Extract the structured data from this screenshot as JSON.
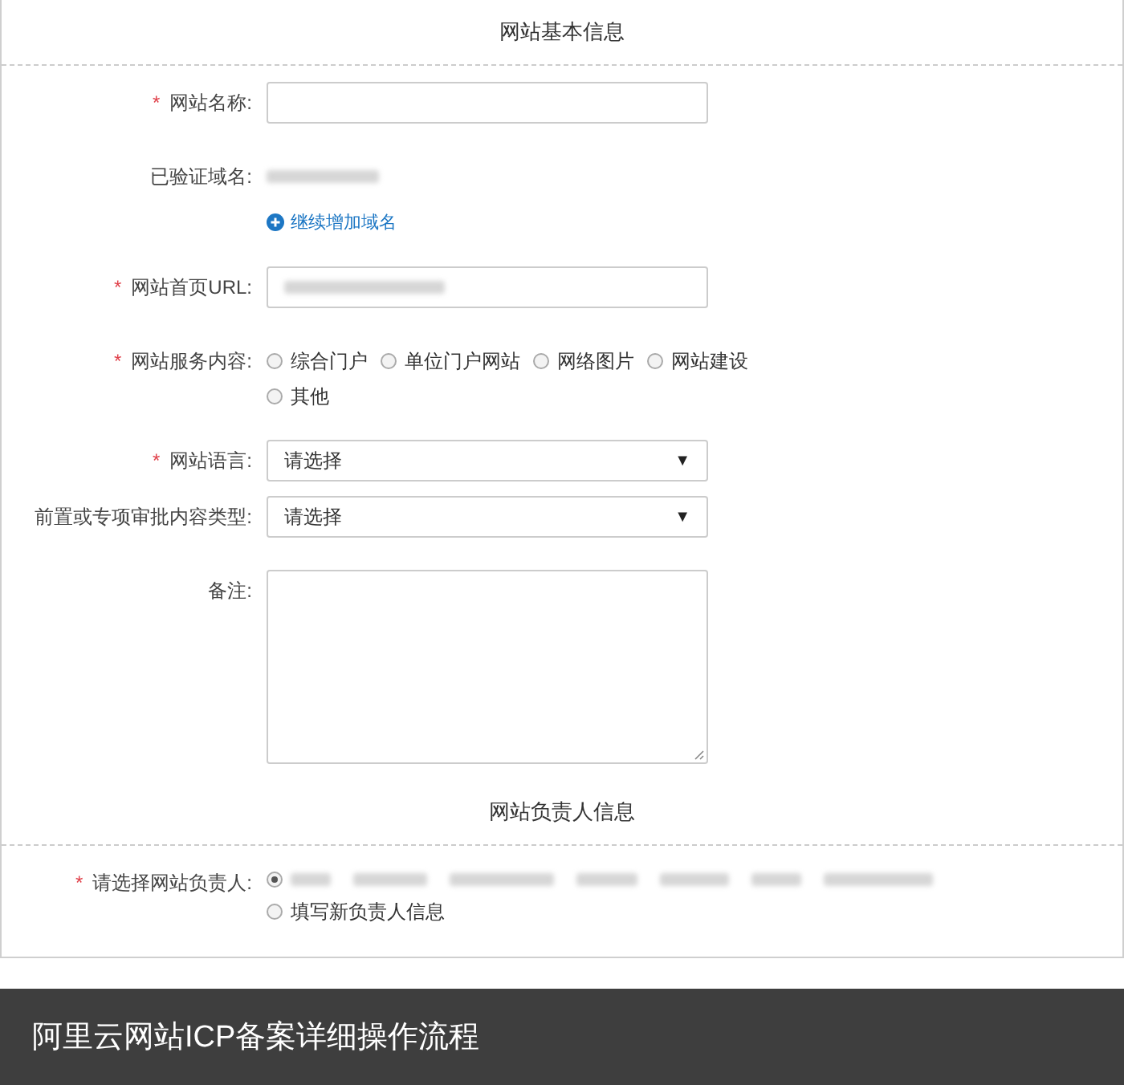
{
  "sections": [
    {
      "title": "网站基本信息",
      "fields": [
        {
          "kind": "input",
          "label": "网站名称:",
          "mark": "*"
        },
        {
          "kind": "static",
          "label": "已验证域名:",
          "redacted": true,
          "link": "继续增加域名"
        },
        {
          "kind": "input",
          "label": "网站首页URL:",
          "mark": "*",
          "redacted": true
        },
        {
          "kind": "radios",
          "label": "网站服务内容:",
          "mark": "*",
          "options": [
            {
              "label": "综合门户",
              "selected": false
            },
            {
              "label": "单位门户网站",
              "selected": false
            },
            {
              "label": "网络图片",
              "selected": false
            },
            {
              "label": "网站建设",
              "selected": false
            },
            {
              "label": "其他",
              "selected": false
            }
          ]
        },
        {
          "kind": "select",
          "label": "网站语言:",
          "mark": "*",
          "value": "请选择",
          "caret": "▼"
        },
        {
          "kind": "select",
          "label": "前置或专项审批内容类型:",
          "value": "请选择",
          "caret": "▼"
        },
        {
          "kind": "textarea",
          "label": "备注:"
        }
      ]
    },
    {
      "title": "网站负责人信息",
      "fields": [
        {
          "kind": "radios",
          "label": "请选择网站负责人:",
          "mark": "*",
          "options": [
            {
              "redacted": true,
              "selected": true
            },
            {
              "label": "填写新负责人信息",
              "selected": false
            }
          ]
        }
      ]
    }
  ],
  "caption": "阿里云网站ICP备案详细操作流程"
}
